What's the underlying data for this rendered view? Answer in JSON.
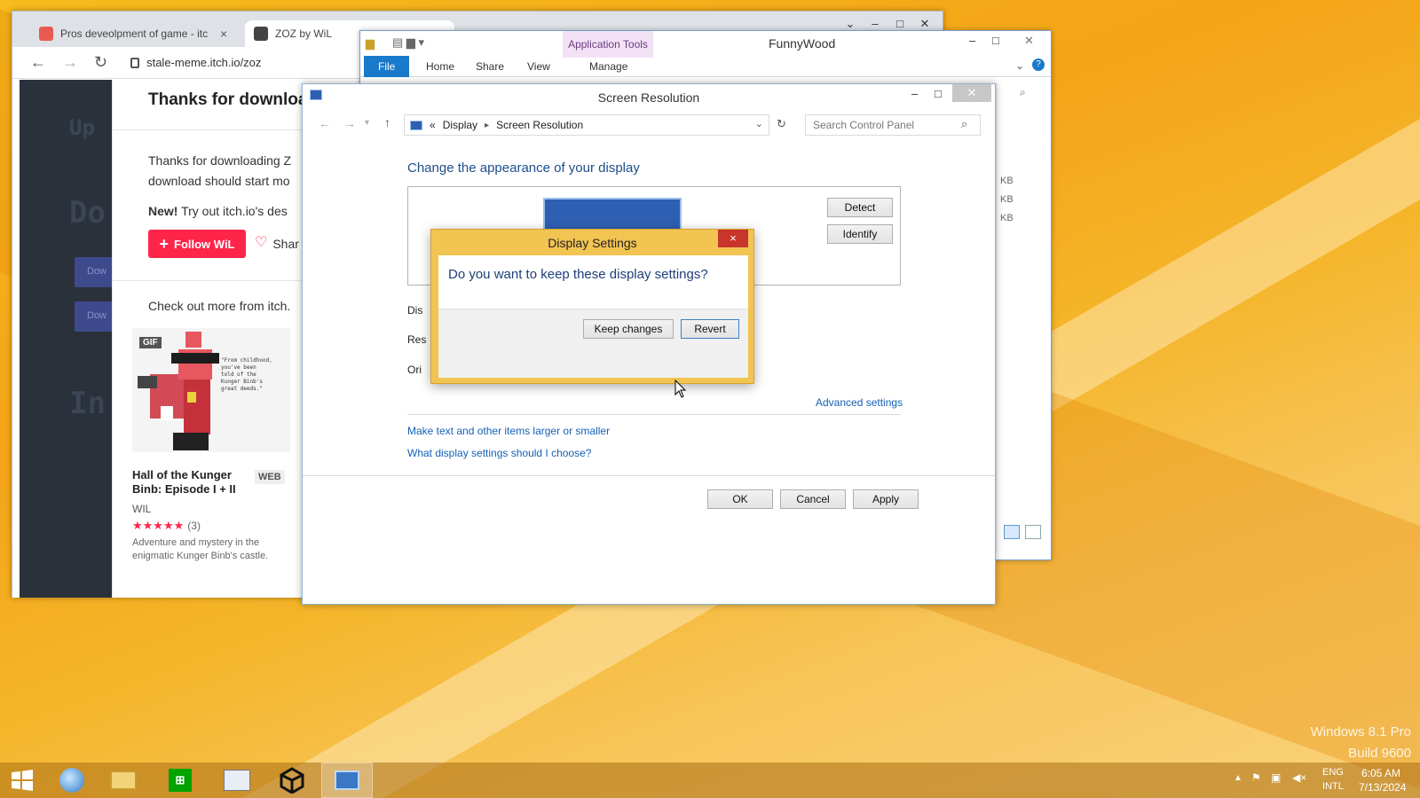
{
  "desktop": {
    "watermark_line1": "Windows 8.1 Pro",
    "watermark_line2": "Build 9600"
  },
  "browser": {
    "tabs": [
      {
        "label": "Pros deveolpment of game - itc",
        "close": "×"
      },
      {
        "label": "ZOZ by WiL"
      }
    ],
    "url": "stale-meme.itch.io/zoz",
    "page": {
      "heading": "Thanks for downloa",
      "line1": "Thanks for downloading Z",
      "line2": "download should start mo",
      "new_label": "New!",
      "new_text": " Try out itch.io's des",
      "follow_label": "Follow WiL",
      "share_label": "Shar",
      "check_out": "Check out more from itch.",
      "card": {
        "gif_badge": "GIF",
        "title": "Hall of the Kunger Binb: Episode I + II",
        "platform": "WEB",
        "author": "WIL",
        "stars": "★★★★★",
        "rating_count": "(3)",
        "description": "Adventure and mystery in the enigmatic Kunger Binb's castle."
      },
      "bg_ghosts": [
        "Up",
        "Do",
        "In"
      ],
      "bg_buttons": [
        "Dow",
        "Dow"
      ]
    }
  },
  "explorer": {
    "title": "FunnyWood",
    "context_tab": "Application Tools",
    "ribbon_tabs": [
      "File",
      "Home",
      "Share",
      "View",
      "Manage"
    ],
    "sizes": [
      "KB",
      "KB",
      "KB"
    ]
  },
  "screen_resolution": {
    "title": "Screen Resolution",
    "breadcrumb": [
      "«",
      "Display",
      "Screen Resolution"
    ],
    "search_placeholder": "Search Control Panel",
    "heading": "Change the appearance of your display",
    "detect_label": "Detect",
    "identify_label": "Identify",
    "field_labels": [
      "Dis",
      "Res",
      "Ori"
    ],
    "advanced_link": "Advanced settings",
    "link_text_size": "Make text and other items larger or smaller",
    "link_which": "What display settings should I choose?",
    "ok_label": "OK",
    "cancel_label": "Cancel",
    "apply_label": "Apply"
  },
  "dialog": {
    "title": "Display Settings",
    "question": "Do you want to keep these display settings?",
    "keep_label": "Keep changes",
    "revert_label": "Revert",
    "close": "×"
  },
  "taskbar": {
    "apps": [
      "start-icon",
      "ie-browser-icon",
      "file-explorer-icon",
      "store-icon",
      "image-viewer-icon",
      "unity-icon",
      "control-panel-icon"
    ],
    "lang_top": "ENG",
    "lang_bottom": "INTL",
    "time": "6:05 AM",
    "date": "7/13/2024"
  },
  "colors": {
    "itch_red": "#ff2449",
    "link_blue": "#1560b5",
    "dialog_border": "#f2c452",
    "explorer_file_tab": "#1979ca"
  }
}
